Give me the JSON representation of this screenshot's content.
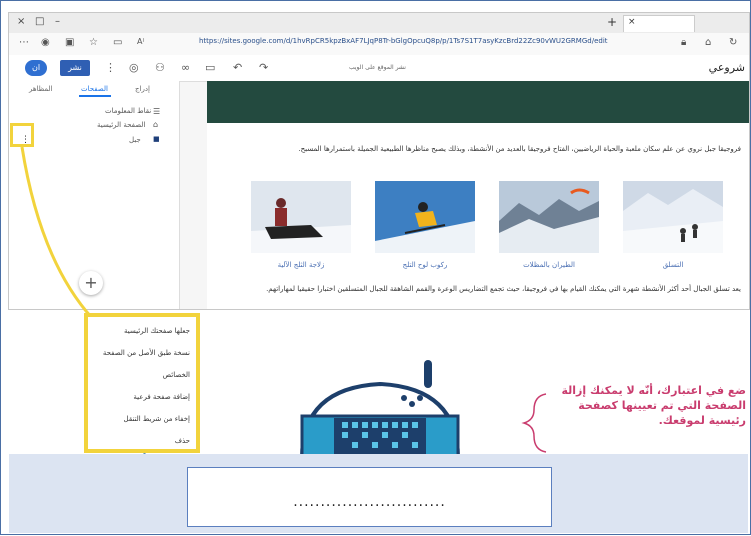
{
  "browser": {
    "window_controls": {
      "close": "×",
      "restore": "□",
      "minimize": "–"
    },
    "new_tab": "+",
    "tab_close": "×",
    "url": "https://sites.google.com/d/1hvRpCR5kpzBxAF7LJqP8Tr-bGlgOpcuQ8p/p/1Ts7S1T7asyKzcBrd22Zc90vWU2GRMGd/edit"
  },
  "editor": {
    "avatar_initials": "ان",
    "publish_label": "نشر",
    "path_label": "نشر الموقع على الويب",
    "site_name": "شروعي",
    "panel_tabs": {
      "insert": "إدراج",
      "pages": "الصفحات",
      "themes": "المظاهر"
    },
    "panel_items": [
      "نقاط المعلومات",
      "الصفحة الرئيسية",
      "جبل"
    ],
    "add_button": "+",
    "intro_text": "فروجيقا جبل نروي عن علم سكان ملعبة والحياة الرياضيين، الفتاح فروجيقا بالعديد من الأنشطة، وبذلك يصبح مناظرها الطبيعية الجميلة باستمرارها المسبح.",
    "photos": [
      {
        "caption": "التسلق",
        "scene": "skiers"
      },
      {
        "caption": "الطيران بالمظلات",
        "scene": "paraglider"
      },
      {
        "caption": "ركوب لوح التلج",
        "scene": "skier"
      },
      {
        "caption": "زلاجة الثلج الآلية",
        "scene": "snowmobile"
      }
    ],
    "footer_text": "يعد تسلق الجبال أحد أكثر الأنشطة شهرة التي يمكنك القيام بها في فروجيقا، حيث تجمع التضاريس الوعرة والقمم الشاهقة للجبال المتسلقين اختبارا حقيقيا لمهاراتهم."
  },
  "context_menu": {
    "items": [
      "جعلها صفحتك الرئيسية",
      "نسخة طبق الأصل من الصفحة",
      "الخصائص",
      "إضافة صفحة فرعية",
      "إخفاء من شريط التنقل",
      "حذف"
    ]
  },
  "note": {
    "text": "ضع في اعتبارك، أنّه لا يمكنك إزالة الصفحة التي تم تعيينها كصفحة رئيسية لموقعك."
  },
  "answer_box": {
    "text": "............................"
  },
  "colors": {
    "highlight": "#f2d33c",
    "hero": "#234a3f",
    "note": "#c93c6e",
    "band": "#dce4f2"
  }
}
